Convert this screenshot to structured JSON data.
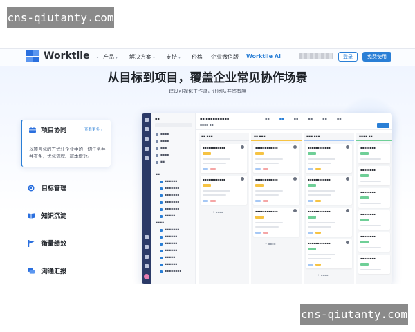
{
  "watermark": {
    "text": "cns-qiutanty.com"
  },
  "nav": {
    "brand": "Worktile",
    "items": [
      {
        "label": "产品",
        "dropdown": true
      },
      {
        "label": "解决方案",
        "dropdown": true
      },
      {
        "label": "支持",
        "dropdown": true
      },
      {
        "label": "价格",
        "dropdown": false
      },
      {
        "label": "企业微信版",
        "dropdown": false
      },
      {
        "label": "Worktile AI",
        "dropdown": false
      }
    ],
    "login_label": "登录",
    "signup_label": "免费使用"
  },
  "hero": {
    "title": "从目标到项目，覆盖企业常见协作场景",
    "subtitle": "建设可视化工作流，让团队井然有序"
  },
  "features": {
    "active": {
      "title": "项目协同",
      "more_link": "查看更多",
      "description": "以项目化的方式让企业中的一切任务井井有条，优化流程、减本增效。"
    },
    "items": [
      {
        "label": "目标管理",
        "icon": "target-icon"
      },
      {
        "label": "知识沉淀",
        "icon": "book-icon"
      },
      {
        "label": "衡量绩效",
        "icon": "flag-icon"
      },
      {
        "label": "沟通汇报",
        "icon": "chat-icon"
      }
    ]
  },
  "colors": {
    "brand_blue": "#2a7fd6",
    "rail_navy": "#2b3a67",
    "heading": "#1f2329"
  }
}
